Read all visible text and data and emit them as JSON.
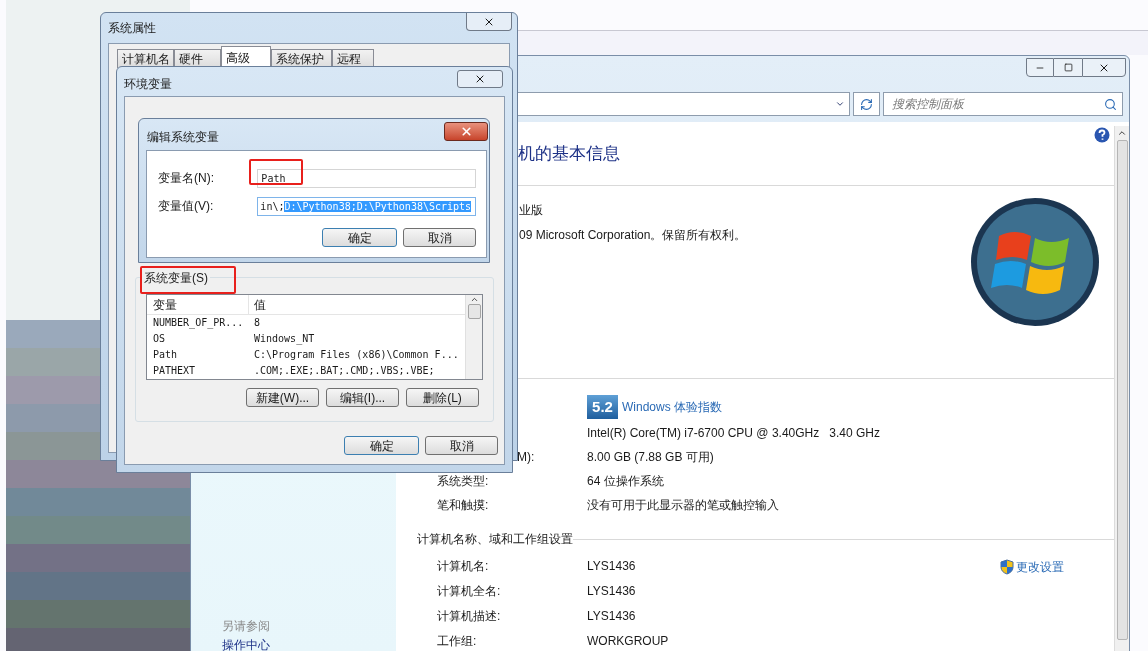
{
  "control_panel": {
    "search": {
      "placeholder": "搜索控制面板"
    },
    "heading": "机的基本信息",
    "edition": "业版",
    "copyright": "09 Microsoft Corporation。保留所有权利。",
    "rating": {
      "score": "5.2",
      "link": "Windows 体验指数"
    },
    "system_rows": [
      {
        "kind": "plain",
        "label": "",
        "value": "Intel(R) Core(TM) i7-6700 CPU @ 3.40GHz   3.40 GHz"
      },
      {
        "kind": "clipped",
        "label": "M):",
        "value": "8.00 GB (7.88 GB 可用)"
      },
      {
        "kind": "plain",
        "label": "系统类型:",
        "value": "64 位操作系统"
      },
      {
        "kind": "plain",
        "label": "笔和触摸:",
        "value": "没有可用于此显示器的笔或触控输入"
      }
    ],
    "name_section": {
      "title": "计算机名称、域和工作组设置",
      "change_link": "更改设置",
      "rows": [
        {
          "label": "计算机名:",
          "value": "LYS1436"
        },
        {
          "label": "计算机全名:",
          "value": "LYS1436"
        },
        {
          "label": "计算机描述:",
          "value": "LYS1436"
        },
        {
          "label": "工作组:",
          "value": "WORKGROUP"
        }
      ]
    },
    "see_also": {
      "title": "另请参阅",
      "links": [
        "操作中心"
      ]
    }
  },
  "system_properties": {
    "title": "系统属性",
    "tabs": [
      {
        "label": "计算机名",
        "selected": false
      },
      {
        "label": "硬件",
        "selected": false
      },
      {
        "label": "高级",
        "selected": true
      },
      {
        "label": "系统保护",
        "selected": false
      },
      {
        "label": "远程",
        "selected": false
      }
    ]
  },
  "environment_variables": {
    "title": "环境变量",
    "group_title": "系统变量(S)",
    "columns": [
      "变量",
      "值"
    ],
    "rows": [
      {
        "name": "NUMBER_OF_PR...",
        "value": "8"
      },
      {
        "name": "OS",
        "value": "Windows_NT"
      },
      {
        "name": "Path",
        "value": "C:\\Program Files (x86)\\Common F..."
      },
      {
        "name": "PATHEXT",
        "value": ".COM;.EXE;.BAT;.CMD;.VBS;.VBE;"
      }
    ],
    "buttons": [
      "新建(W)...",
      "编辑(I)...",
      "删除(L)"
    ],
    "footer_buttons": [
      "确定",
      "取消"
    ]
  },
  "edit_dialog": {
    "title": "编辑系统变量",
    "name_label": "变量名(N):",
    "name_value": "Path",
    "value_label": "变量值(V):",
    "value_plain": "in\\;",
    "value_selected": "D:\\Python38;D:\\Python38\\Scripts",
    "buttons": [
      "确定",
      "取消"
    ]
  }
}
